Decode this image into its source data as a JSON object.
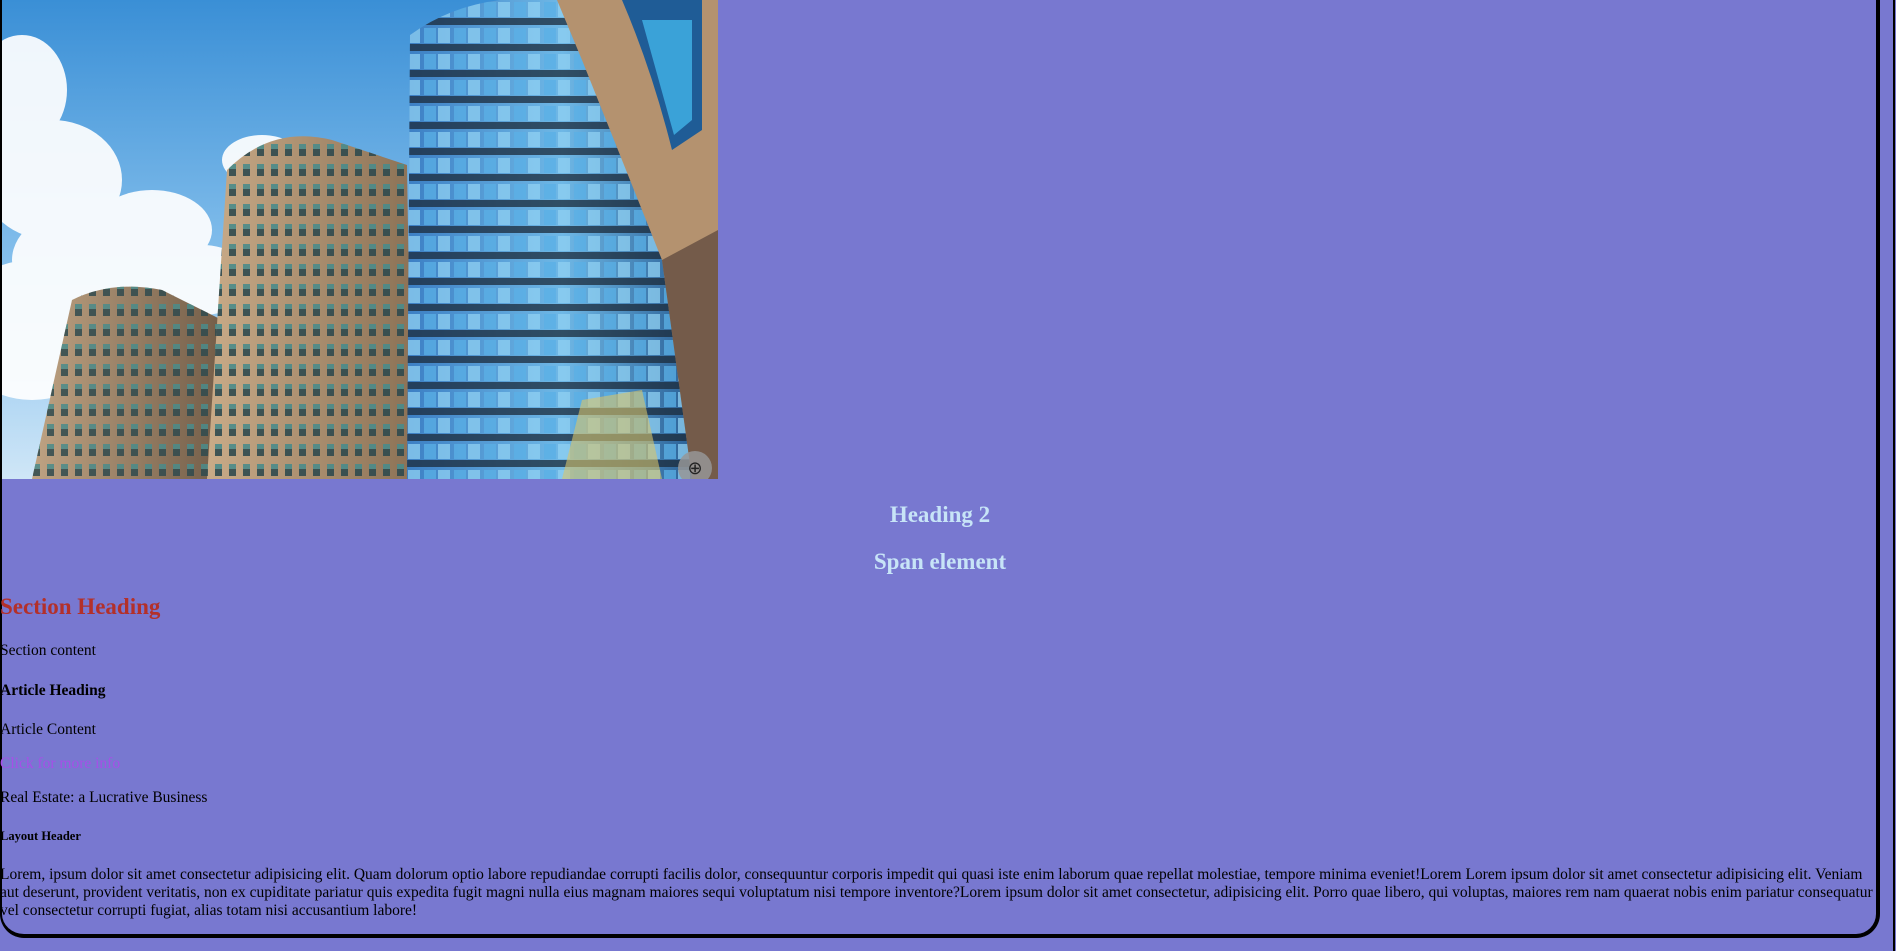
{
  "hero": {
    "image": "office-buildings-photo",
    "zoom_icon": "zoom-in-icon"
  },
  "headings": {
    "h2": "Heading 2",
    "span": "Span element",
    "section": "Section Heading"
  },
  "section": {
    "content": "Section content"
  },
  "article": {
    "heading": "Article Heading",
    "content": "Article Content"
  },
  "link": {
    "text": "Click for more info"
  },
  "tagline": "Real Estate: a Lucrative Business",
  "layout_header": "Layout Header",
  "paragraph": "Lorem, ipsum dolor sit amet consectetur adipisicing elit. Quam dolorum optio labore repudiandae corrupti facilis dolor, consequuntur corporis impedit qui quasi iste enim laborum quae repellat molestiae, tempore minima eveniet!Lorem Lorem ipsum dolor sit amet consectetur adipisicing elit. Veniam aut deserunt, provident veritatis, non ex cupiditate pariatur quis expedita fugit magni nulla eius magnam maiores sequi voluptatum nisi tempore inventore?Lorem ipsum dolor sit amet consectetur, adipisicing elit. Porro quae libero, qui voluptas, maiores rem nam quaerat nobis enim pariatur consequatur vel consectetur corrupti fugiat, alias totam nisi accusantium labore!",
  "colors": {
    "background": "#7878d0",
    "heading_light": "#c7e4f7",
    "section_heading": "#b3302a",
    "link": "#a64fe8"
  }
}
